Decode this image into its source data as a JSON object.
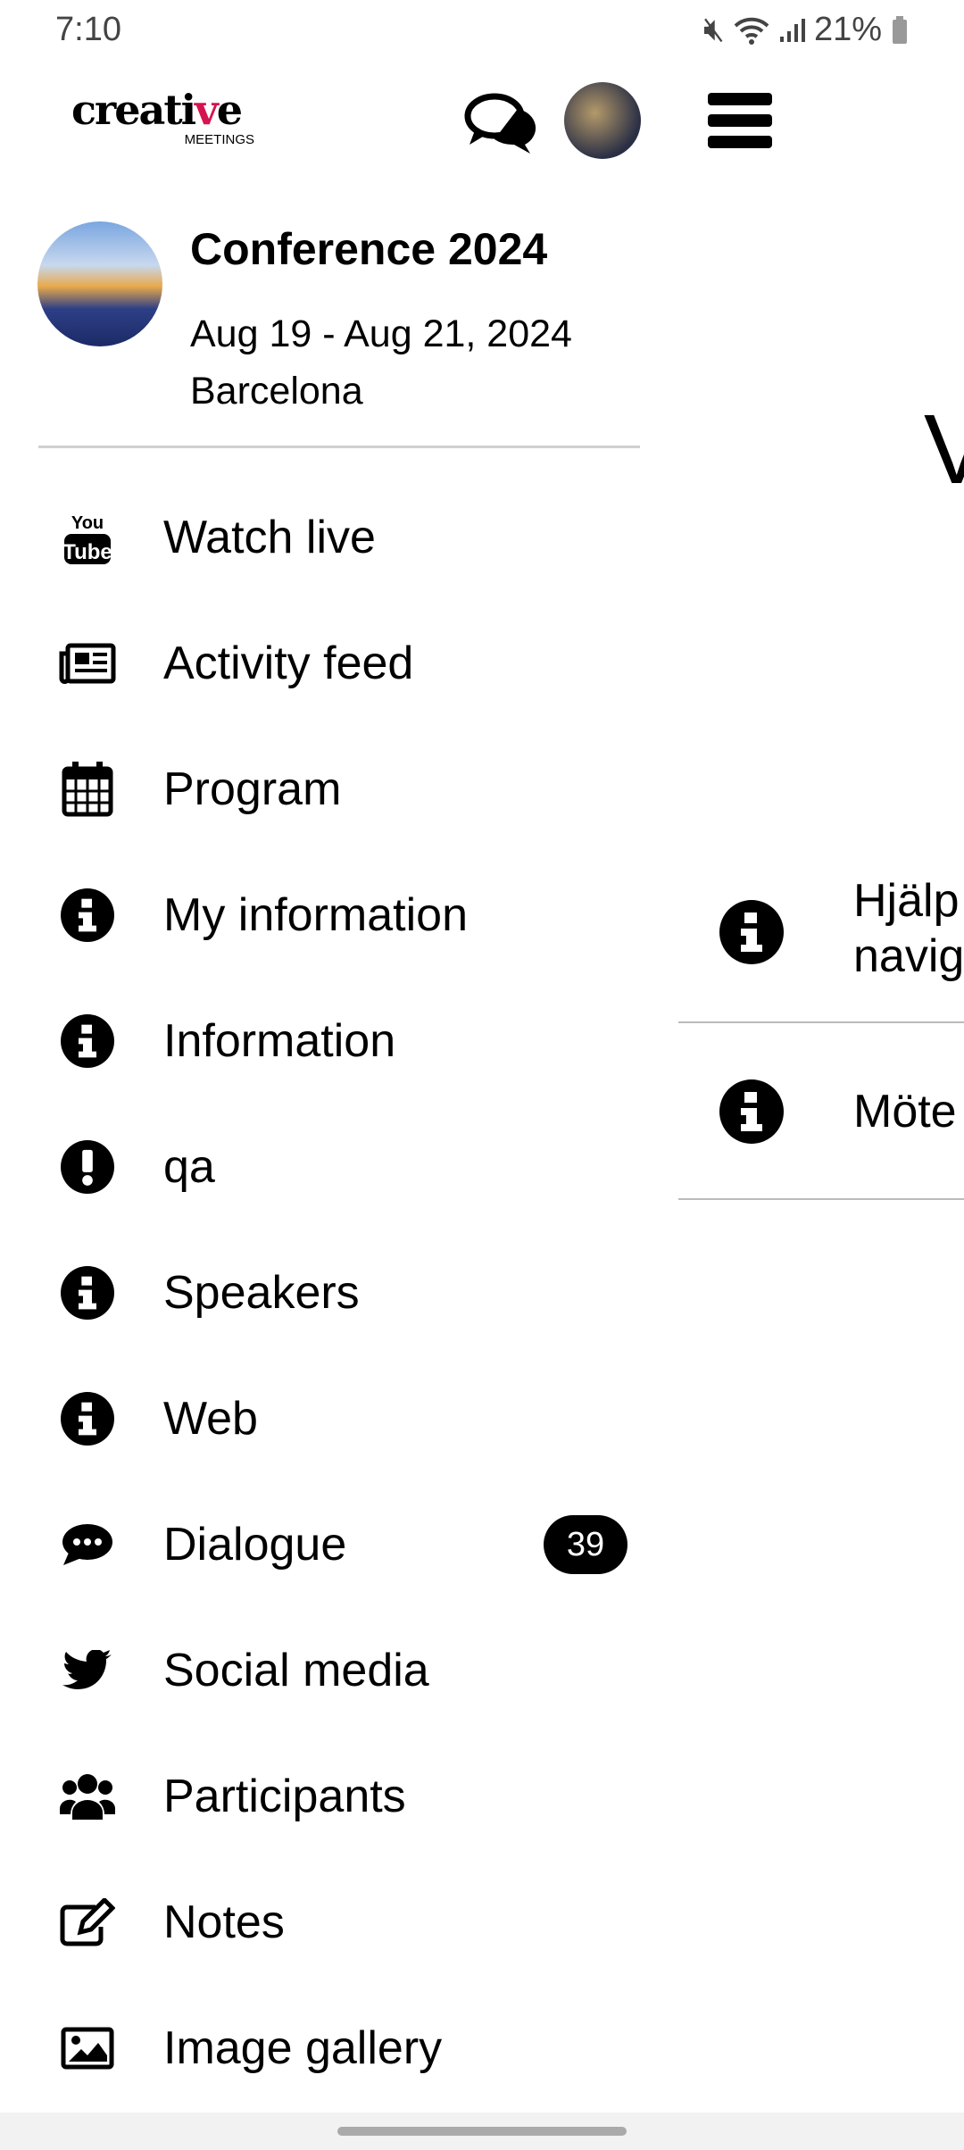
{
  "status_bar": {
    "time": "7:10",
    "battery": "21%"
  },
  "header": {
    "logo_text": "creative",
    "logo_sub": "MEETINGS"
  },
  "event": {
    "title": "Conference 2024",
    "dates": "Aug 19 - Aug 21, 2024",
    "location": "Barcelona"
  },
  "menu": {
    "items": [
      {
        "label": "Watch live",
        "icon": "youtube-icon"
      },
      {
        "label": "Activity feed",
        "icon": "newspaper-icon"
      },
      {
        "label": "Program",
        "icon": "calendar-icon"
      },
      {
        "label": "My information",
        "icon": "info-icon"
      },
      {
        "label": "Information",
        "icon": "info-icon"
      },
      {
        "label": "qa",
        "icon": "exclamation-icon"
      },
      {
        "label": "Speakers",
        "icon": "info-icon"
      },
      {
        "label": "Web",
        "icon": "info-icon"
      },
      {
        "label": "Dialogue",
        "icon": "comment-icon",
        "badge": "39"
      },
      {
        "label": "Social media",
        "icon": "twitter-icon"
      },
      {
        "label": "Participants",
        "icon": "users-icon"
      },
      {
        "label": "Notes",
        "icon": "edit-icon"
      },
      {
        "label": "Image gallery",
        "icon": "image-icon"
      }
    ]
  },
  "background": {
    "heading": "V",
    "items": [
      {
        "label_line1": "Hjälp",
        "label_line2": "navig"
      },
      {
        "label_line1": "Möte"
      }
    ]
  }
}
